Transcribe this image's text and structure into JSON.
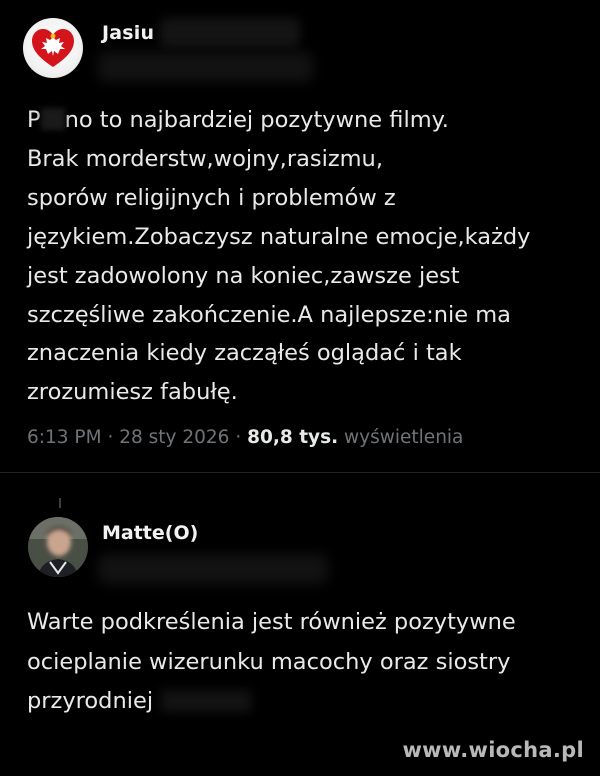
{
  "post": {
    "author_name": "Jasiu",
    "text_prefix": "P",
    "lines": [
      "no to najbardziej pozytywne filmy.",
      "Brak morderstw,wojny,rasizmu,",
      "sporów religijnych i problemów z",
      "językiem.Zobaczysz naturalne emocje,każdy",
      "jest zadowolony na koniec,zawsze jest",
      "szczęśliwe zakończenie.A najlepsze:nie ma",
      "znaczenia kiedy zacząłeś oglądać i tak",
      "zrozumiesz fabułę."
    ],
    "time": "6:13 PM",
    "date": "28 sty 2026",
    "separator": "·",
    "views_count": "80,8 tys.",
    "views_label": "wyświetlenia"
  },
  "reply": {
    "author_name": "Matte(O)",
    "lines": [
      "Warte podkreślenia jest również pozytywne",
      "ocieplanie wizerunku macochy oraz siostry",
      "przyrodniej"
    ]
  },
  "watermark": "www.wiocha.pl",
  "colors": {
    "background": "#000000",
    "text": "#e9e9e9",
    "muted": "#6f7478",
    "eagle_red": "#d4141b"
  },
  "icons": {
    "post_avatar": "polish-eagle-heart-icon",
    "reply_avatar": "blurred-face-photo"
  }
}
